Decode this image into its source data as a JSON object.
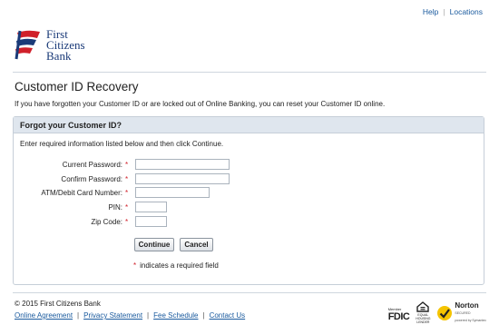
{
  "top_nav": {
    "help": "Help",
    "locations": "Locations"
  },
  "brand": {
    "line1": "First",
    "line2": "Citizens",
    "line3": "Bank",
    "color": "#1a3a78",
    "accent": "#d0202a"
  },
  "page": {
    "title": "Customer ID Recovery",
    "intro": "If you have forgotten your Customer ID or are locked out of Online Banking, you can reset your Customer ID online."
  },
  "panel": {
    "heading": "Forgot your Customer ID?",
    "instructions": "Enter required information listed below and then click Continue."
  },
  "form": {
    "current_password": {
      "label": "Current Password:",
      "value": ""
    },
    "confirm_password": {
      "label": "Confirm Password:",
      "value": ""
    },
    "card_number": {
      "label": "ATM/Debit Card Number:",
      "value": ""
    },
    "pin": {
      "label": "PIN:",
      "value": ""
    },
    "zip": {
      "label": "Zip Code:",
      "value": ""
    },
    "required_marker": "*",
    "continue_label": "Continue",
    "cancel_label": "Cancel",
    "required_note": "indicates a required field"
  },
  "footer": {
    "copyright": "© 2015 First Citizens Bank",
    "links": [
      "Online Agreement",
      "Privacy Statement",
      "Fee Schedule",
      "Contact Us"
    ],
    "fdic_sub": "Member",
    "fdic": "FDIC",
    "ehl": "EQUAL HOUSING LENDER",
    "norton": "Norton",
    "norton_secured": "SECURED",
    "norton_by": "powered by Symantec"
  },
  "colors": {
    "link": "#1a5a9e",
    "required": "#d0202a",
    "panel_header": "#dfe6ee"
  },
  "icons": [
    "first-citizens-flag-logo-icon",
    "equal-housing-icon",
    "norton-check-icon"
  ]
}
